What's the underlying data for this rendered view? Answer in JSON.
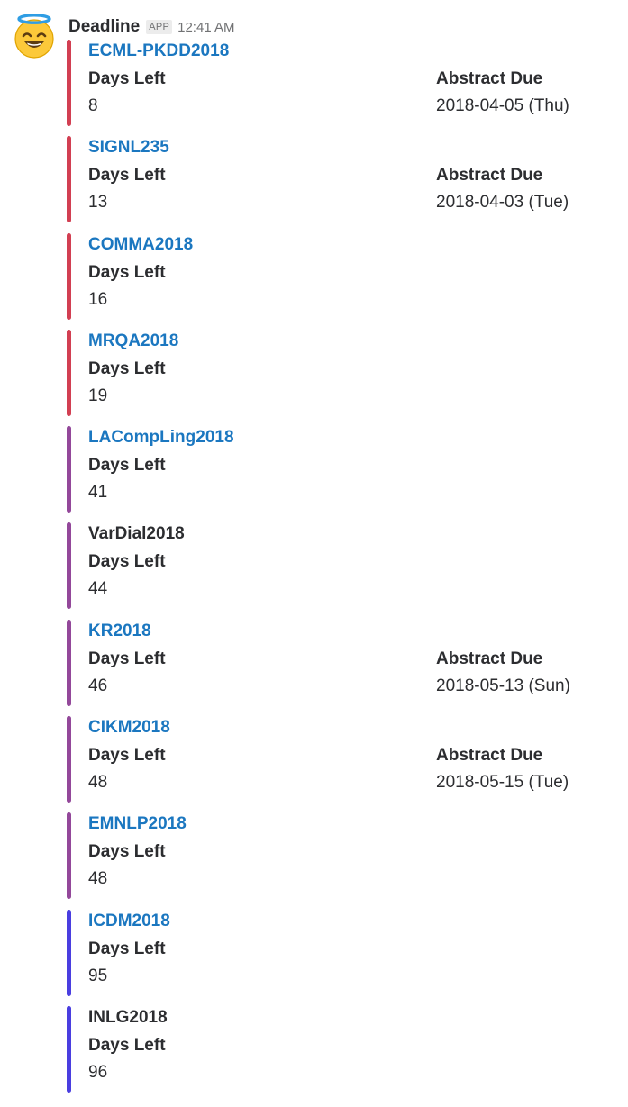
{
  "message": {
    "sender": "Deadline",
    "badge": "APP",
    "timestamp": "12:41 AM",
    "avatar_icon": "smiling-face-with-halo-icon"
  },
  "field_labels": {
    "days_left": "Days Left",
    "abstract_due": "Abstract Due"
  },
  "attachments": [
    {
      "title": "ECML-PKDD2018",
      "linked": true,
      "color": "#d23f52",
      "days_left": "8",
      "abstract_due": "2018-04-05 (Thu)"
    },
    {
      "title": "SIGNL235",
      "linked": true,
      "color": "#d23f52",
      "days_left": "13",
      "abstract_due": "2018-04-03 (Tue)"
    },
    {
      "title": "COMMA2018",
      "linked": true,
      "color": "#d23f52",
      "days_left": "16",
      "abstract_due": null
    },
    {
      "title": "MRQA2018",
      "linked": true,
      "color": "#d23f52",
      "days_left": "19",
      "abstract_due": null
    },
    {
      "title": "LACompLing2018",
      "linked": true,
      "color": "#93489a",
      "days_left": "41",
      "abstract_due": null
    },
    {
      "title": "VarDial2018",
      "linked": false,
      "color": "#93489a",
      "days_left": "44",
      "abstract_due": null
    },
    {
      "title": "KR2018",
      "linked": true,
      "color": "#93489a",
      "days_left": "46",
      "abstract_due": "2018-05-13 (Sun)"
    },
    {
      "title": "CIKM2018",
      "linked": true,
      "color": "#93489a",
      "days_left": "48",
      "abstract_due": "2018-05-15 (Tue)"
    },
    {
      "title": "EMNLP2018",
      "linked": true,
      "color": "#93489a",
      "days_left": "48",
      "abstract_due": null
    },
    {
      "title": "ICDM2018",
      "linked": true,
      "color": "#4a3ee0",
      "days_left": "95",
      "abstract_due": null
    },
    {
      "title": "INLG2018",
      "linked": false,
      "color": "#4a3ee0",
      "days_left": "96",
      "abstract_due": null
    }
  ]
}
